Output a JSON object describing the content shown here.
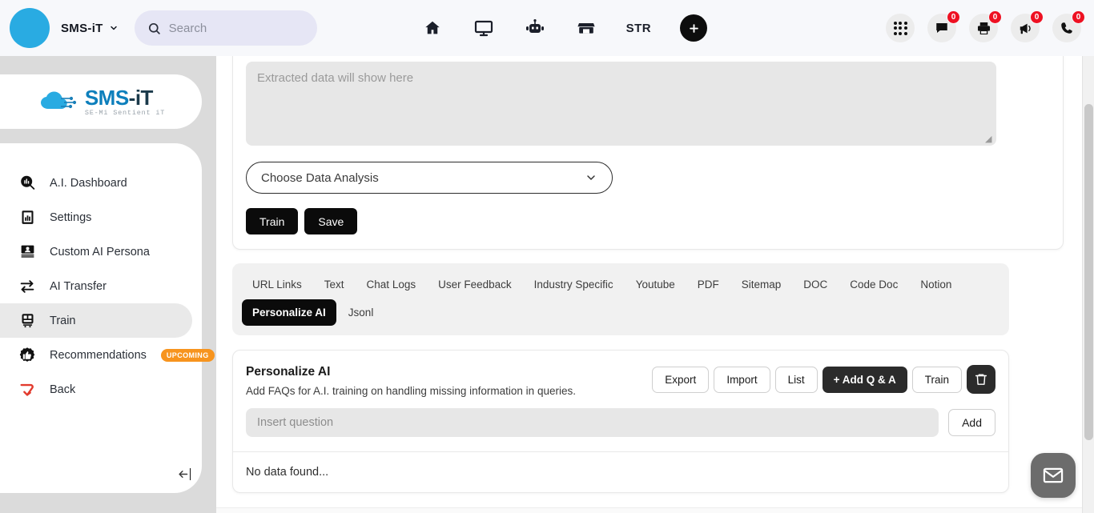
{
  "topbar": {
    "brand_name": "SMS-iT",
    "brand_caret_icon": "chevron-down-icon",
    "search": {
      "placeholder": "Search",
      "value": "",
      "icon": "search-icon"
    },
    "nav_center": [
      {
        "icon": "home-icon",
        "label": ""
      },
      {
        "icon": "monitor-icon",
        "label": ""
      },
      {
        "icon": "robot-icon",
        "label": ""
      },
      {
        "icon": "store-icon",
        "label": ""
      },
      {
        "icon": "str-text",
        "label": "STR"
      },
      {
        "icon": "plus-icon",
        "label": ""
      }
    ],
    "nav_right": [
      {
        "icon": "apps-grid-icon",
        "badge": ""
      },
      {
        "icon": "chat-bubble-icon",
        "badge": "0"
      },
      {
        "icon": "printer-icon",
        "badge": "0"
      },
      {
        "icon": "megaphone-icon",
        "badge": "0"
      },
      {
        "icon": "phone-icon",
        "badge": "0"
      }
    ]
  },
  "sidebar": {
    "logo": {
      "main": "SMS",
      "dash": "-iT",
      "sub": "SE-Mi Sentient iT"
    },
    "items": [
      {
        "label": "A.I. Dashboard",
        "icon": "analytics-search-icon",
        "active": false,
        "badge": ""
      },
      {
        "label": "Settings",
        "icon": "report-chart-icon",
        "active": false,
        "badge": ""
      },
      {
        "label": "Custom AI Persona",
        "icon": "id-card-icon",
        "active": false,
        "badge": ""
      },
      {
        "label": "AI Transfer",
        "icon": "transfer-arrows-icon",
        "active": false,
        "badge": ""
      },
      {
        "label": "Train",
        "icon": "train-icon",
        "active": true,
        "badge": ""
      },
      {
        "label": "Recommendations",
        "icon": "thumbs-up-icon",
        "active": false,
        "badge": "UPCOMING"
      },
      {
        "label": "Back",
        "icon": "return-arrow-icon",
        "active": false,
        "badge": ""
      }
    ],
    "collapse_icon": "collapse-left-icon"
  },
  "main": {
    "extracted": {
      "placeholder": "Extracted data will show here",
      "value": ""
    },
    "data_analysis_select": {
      "value": "Choose Data Analysis",
      "caret_icon": "chevron-down-icon"
    },
    "train_button": "Train",
    "save_button": "Save",
    "tabs": [
      {
        "label": "URL Links",
        "active": false
      },
      {
        "label": "Text",
        "active": false
      },
      {
        "label": "Chat Logs",
        "active": false
      },
      {
        "label": "User Feedback",
        "active": false
      },
      {
        "label": "Industry Specific",
        "active": false
      },
      {
        "label": "Youtube",
        "active": false
      },
      {
        "label": "PDF",
        "active": false
      },
      {
        "label": "Sitemap",
        "active": false
      },
      {
        "label": "DOC",
        "active": false
      },
      {
        "label": "Code Doc",
        "active": false
      },
      {
        "label": "Notion",
        "active": false
      },
      {
        "label": "Personalize AI",
        "active": true
      },
      {
        "label": "Jsonl",
        "active": false
      }
    ],
    "panel": {
      "title": "Personalize AI",
      "subtitle": "Add FAQs for A.I. training on handling missing information in queries.",
      "actions": [
        {
          "label": "Export",
          "style": "outline"
        },
        {
          "label": "Import",
          "style": "outline"
        },
        {
          "label": "List",
          "style": "outline"
        },
        {
          "label": "+ Add Q & A",
          "style": "dark"
        },
        {
          "label": "Train",
          "style": "outline"
        }
      ],
      "delete_icon": "trash-icon",
      "question_input": {
        "placeholder": "Insert question",
        "value": ""
      },
      "add_button": "Add",
      "empty_state": "No data found..."
    }
  },
  "fab": {
    "icon": "mail-envelope-icon"
  },
  "colors": {
    "accent": "#29ABE2",
    "logo_blue": "#0d7fbc",
    "badge_red": "#ee1122",
    "upcoming_orange": "#f7941e",
    "dark": "#0b0b0b"
  }
}
